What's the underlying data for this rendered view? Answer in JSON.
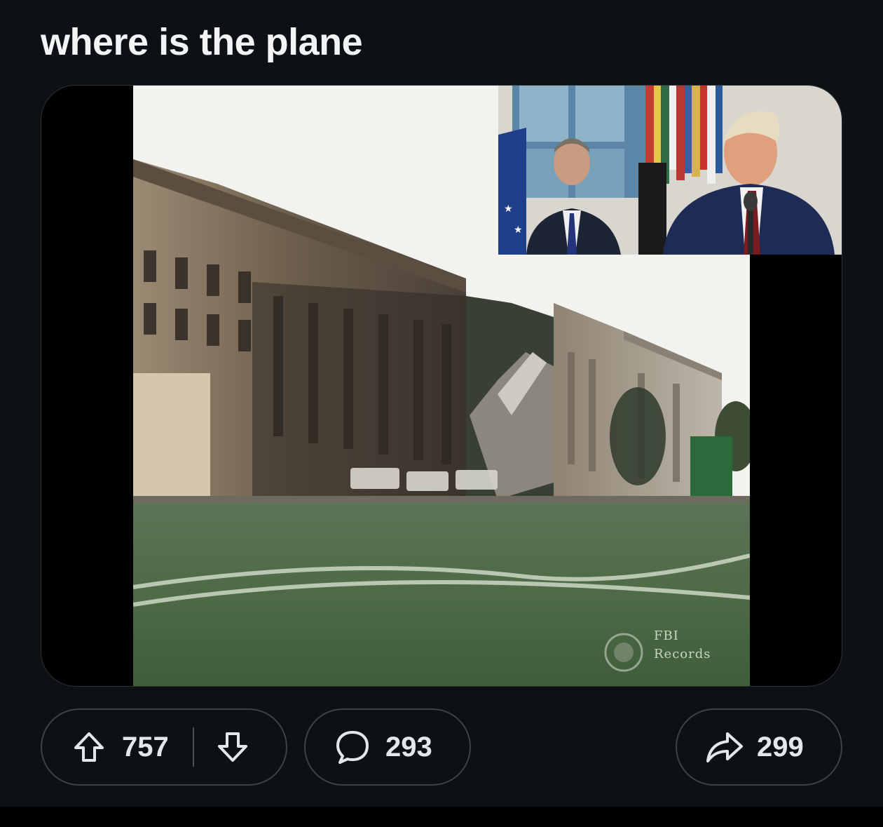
{
  "post": {
    "title": "where is the plane"
  },
  "media": {
    "watermark": {
      "line1": "FBI",
      "line2": "Records"
    }
  },
  "actions": {
    "upvote_icon": "arrow-up-outline-icon",
    "downvote_icon": "arrow-down-outline-icon",
    "vote_count": "757",
    "comment_icon": "speech-bubble-icon",
    "comment_count": "293",
    "share_icon": "share-arrow-icon",
    "share_count": "299"
  },
  "colors": {
    "background": "#0e1113",
    "pill_border": "#3b4348",
    "text": "#e3e7e9"
  }
}
